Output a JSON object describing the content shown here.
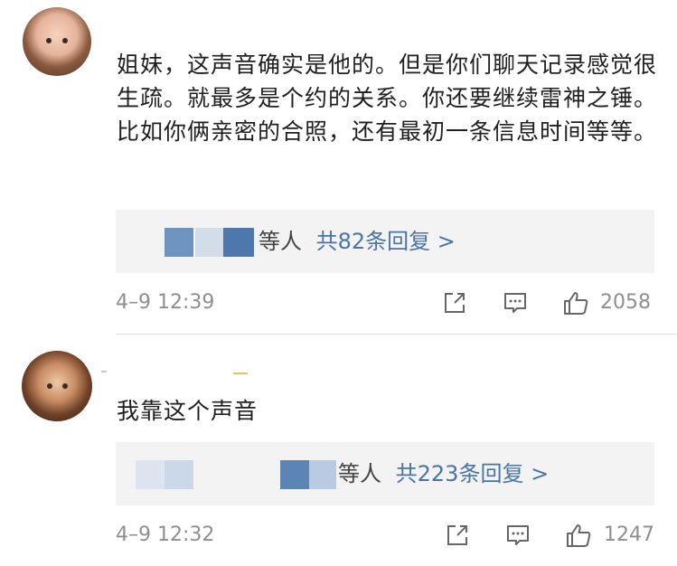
{
  "comments": [
    {
      "text": "姐妹，这声音确实是他的。但是你们聊天记录感觉很生疏。就最多是个约的关系。你还要继续雷神之锤。比如你俩亲密的合照，还有最初一条信息时间等等。",
      "replies": {
        "suffix": "等人",
        "link": "共82条回复 >"
      },
      "time": "4–9 12:39",
      "likes": "2058"
    },
    {
      "text": "我靠这个声音",
      "replies": {
        "suffix": "等人",
        "link": "共223条回复 >"
      },
      "time": "4–9 12:32",
      "likes": "1247"
    }
  ],
  "icons": [
    "share-icon",
    "comment-icon",
    "like-icon"
  ],
  "colors": {
    "link": "#4a73a8",
    "meta": "#8f8f8f",
    "reply_bg": "#f3f3f3",
    "censor_dark": "#5b86b8",
    "censor_light": "#c9d7e8"
  }
}
